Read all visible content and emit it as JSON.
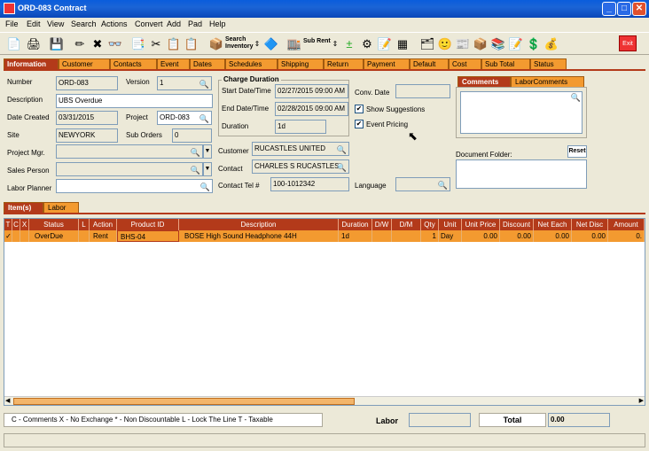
{
  "window": {
    "title": "ORD-083 Contract",
    "min": "_",
    "max": "□",
    "close": "✕"
  },
  "menu": [
    "File",
    "Edit",
    "View",
    "Search",
    "Actions",
    "Convert",
    "Add",
    "Pad",
    "Help"
  ],
  "toolbar": {
    "search_inventory": "Search Inventory",
    "sub_rent": "Sub Rent",
    "exit": "Exit"
  },
  "tabs": [
    "Information",
    "Customer",
    "Contacts",
    "Event",
    "Dates",
    "Schedules",
    "Shipping",
    "Return",
    "Payment",
    "Default",
    "Cost",
    "Sub Total",
    "Status"
  ],
  "form": {
    "number_label": "Number",
    "number": "ORD-083",
    "version_label": "Version",
    "version": "1",
    "description_label": "Description",
    "description": "UBS Overdue",
    "date_created_label": "Date Created",
    "date_created": "03/31/2015",
    "project_label": "Project",
    "project": "ORD-083",
    "site_label": "Site",
    "site": "NEWYORK",
    "sub_orders_label": "Sub Orders",
    "sub_orders": "0",
    "project_mgr_label": "Project Mgr.",
    "project_mgr": "",
    "sales_person_label": "Sales Person",
    "sales_person": "",
    "labor_planner_label": "Labor Planner",
    "labor_planner": "",
    "charge_duration_title": "Charge Duration",
    "start_label": "Start Date/Time",
    "start": "02/27/2015 09:00 AM",
    "end_label": "End Date/Time",
    "end": "02/28/2015 09:00 AM",
    "duration_label": "Duration",
    "duration": "1d",
    "customer_label": "Customer",
    "customer": "RUCASTLES UNITED",
    "contact_label": "Contact",
    "contact": "CHARLES S RUCASTLES",
    "contact_tel_label": "Contact Tel #",
    "contact_tel": "100-1012342",
    "conv_date_label": "Conv. Date",
    "conv_date": "",
    "show_suggestions": "Show Suggestions",
    "event_pricing": "Event Pricing",
    "language_label": "Language",
    "language": "",
    "comments_tab": "Comments",
    "labor_comments_tab": "LaborComments",
    "document_folder_label": "Document Folder:",
    "reset": "Reset"
  },
  "subtabs": [
    "Item(s)",
    "Labor"
  ],
  "grid": {
    "headers": [
      "T",
      "C",
      "X",
      "Status",
      "L",
      "Action",
      "Product ID",
      "Description",
      "Duration",
      "D/W",
      "D/M",
      "Qty",
      "Unit",
      "Unit Price",
      "Discount",
      "Net Each",
      "Net Disc",
      "Amount"
    ],
    "rows": [
      {
        "t": "✓",
        "status": "OverDue",
        "action": "Rent",
        "product_id": "BHS-04",
        "description": "BOSE High Sound Headphone 44H",
        "duration": "1d",
        "dw": "",
        "dm": "",
        "qty": "1",
        "unit": "Day",
        "unit_price": "0.00",
        "discount": "0.00",
        "net_each": "0.00",
        "net_disc": "0.00",
        "amount": "0."
      }
    ]
  },
  "footer": {
    "legend": "C - Comments    X - No Exchange    * - Non Discountable    L - Lock The Line    T - Taxable",
    "labor_label": "Labor",
    "labor": "",
    "total_label": "Total",
    "total": "0.00"
  },
  "colors": {
    "accent_orange": "#f39a30",
    "accent_red": "#b33a1a",
    "title_blue": "#0a5ddc"
  }
}
